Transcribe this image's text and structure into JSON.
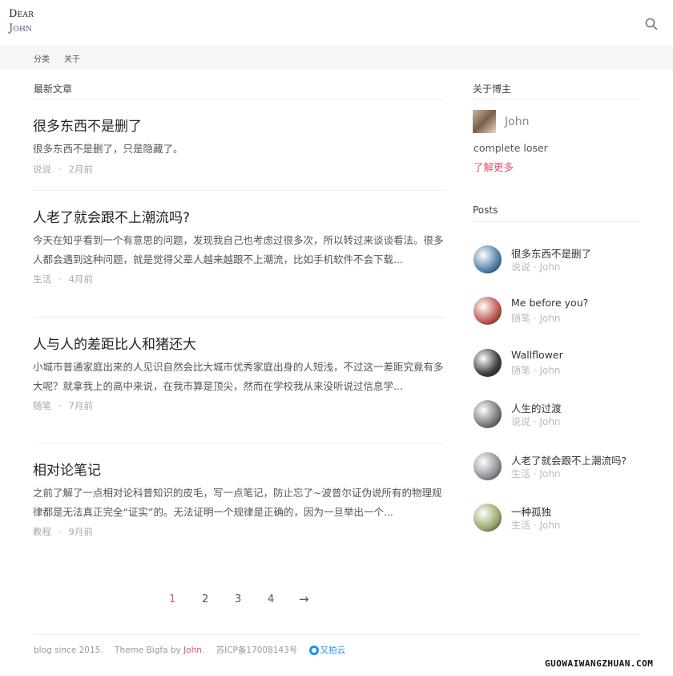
{
  "site": {
    "logo_top": "Dear",
    "logo_bottom": "John",
    "search_icon": "search-icon"
  },
  "nav": [
    "分类",
    "关于"
  ],
  "main": {
    "section_title": "最新文章",
    "articles": [
      {
        "title": "很多东西不是删了",
        "excerpt": "很多东西不是删了，只是隐藏了。",
        "category": "说说",
        "time": "2月前"
      },
      {
        "title": "人老了就会跟不上潮流吗?",
        "excerpt": "今天在知乎看到一个有意思的问题，发现我自己也考虑过很多次，所以转过来谈谈看法。很多人都会遇到这种问题，就是觉得父辈人越来越跟不上潮流，比如手机软件不会下载...",
        "category": "生活",
        "time": "4月前"
      },
      {
        "title": "人与人的差距比人和猪还大",
        "excerpt": "小城市普通家庭出来的人见识自然会比大城市优秀家庭出身的人短浅，不过这一差距究竟有多大呢？就拿我上的高中来说，在我市算是顶尖，然而在学校我从来没听说过信息学...",
        "category": "随笔",
        "time": "7月前"
      },
      {
        "title": "相对论笔记",
        "excerpt": "之前了解了一点相对论科普知识的皮毛，写一点笔记，防止忘了~波普尔证伪说所有的物理规律都是无法真正完全“证实”的。无法证明一个规律是正确的，因为一旦举出一个...",
        "category": "教程",
        "time": "9月前"
      }
    ]
  },
  "pagination": {
    "pages": [
      "1",
      "2",
      "3",
      "4"
    ],
    "next": "→",
    "current": "1"
  },
  "sidebar": {
    "about": {
      "title": "关于博主",
      "name": "John",
      "bio": "complete loser",
      "more": "了解更多"
    },
    "posts": {
      "title": "Posts",
      "items": [
        {
          "title": "很多东西不是删了",
          "meta": "说说 · John",
          "color": "#4f7fa8"
        },
        {
          "title": "Me before you?",
          "meta": "随笔 · John",
          "color": "#b9574d"
        },
        {
          "title": "Wallflower",
          "meta": "随笔 · John",
          "color": "#3b3b3b"
        },
        {
          "title": "人生的过渡",
          "meta": "说说 · John",
          "color": "#777777"
        },
        {
          "title": "人老了就会跟不上潮流吗?",
          "meta": "生活 · John",
          "color": "#8f9096"
        },
        {
          "title": "一种孤独",
          "meta": "生活 · John",
          "color": "#95a86a"
        }
      ]
    }
  },
  "footer": {
    "since": "blog since 2015.",
    "theme_prefix": "Theme Bigfa by ",
    "theme_author": "John",
    "theme_suffix": ".",
    "icp": "苏ICP备17008143号",
    "upyun": "又拍云"
  },
  "watermark": "GUOWAIWANGZHUAN.COM",
  "colors": {
    "accent": "#e0546f",
    "nav_bg": "#f6f6f6"
  }
}
